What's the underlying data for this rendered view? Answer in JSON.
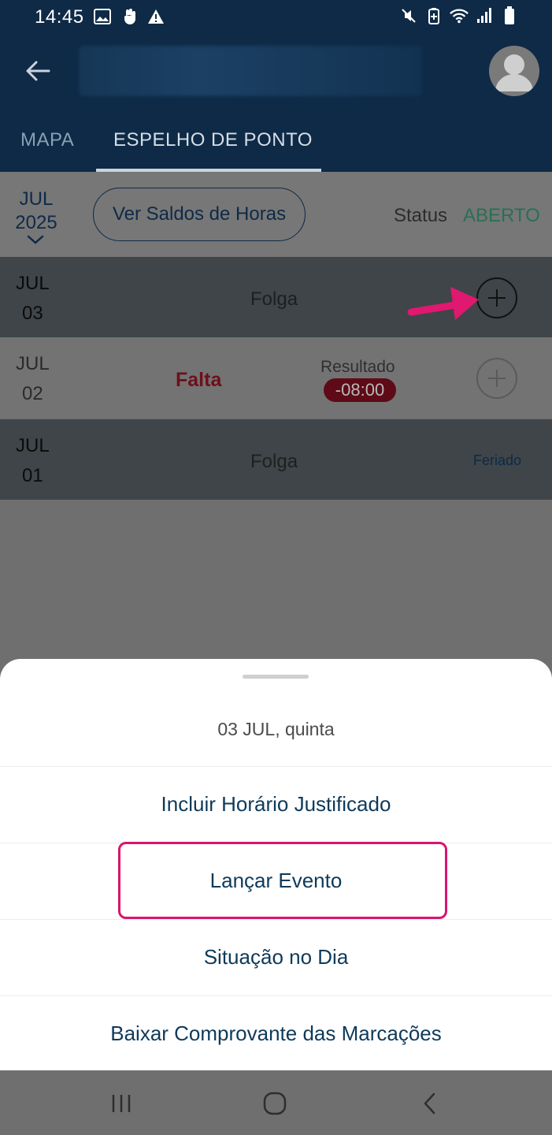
{
  "status_bar": {
    "time": "14:45",
    "left_icons": [
      "image-icon",
      "hand-icon",
      "warning-icon"
    ],
    "right_icons": [
      "mute-icon",
      "battery-saver-icon",
      "wifi-icon",
      "signal-icon",
      "battery-icon"
    ]
  },
  "app_bar": {
    "back_icon": "arrow-left-icon",
    "avatar_icon": "user-icon"
  },
  "tabs": [
    {
      "label": "MAPA",
      "active": false
    },
    {
      "label": "ESPELHO DE PONTO",
      "active": true
    }
  ],
  "period": {
    "month": "JUL",
    "year": "2025",
    "saldos_button": "Ver Saldos de Horas",
    "status_label": "Status",
    "status_value": "ABERTO"
  },
  "days": [
    {
      "month": "JUL",
      "day": "03",
      "label": "Folga"
    },
    {
      "month": "JUL",
      "day": "02",
      "label": "Falta",
      "result_label": "Resultado",
      "result_value": "-08:00"
    },
    {
      "month": "JUL",
      "day": "01",
      "label": "Folga",
      "tag": "Feriado"
    }
  ],
  "sheet": {
    "title": "03 JUL, quinta",
    "items": [
      "Incluir Horário Justificado",
      "Lançar Evento",
      "Situação no Dia",
      "Baixar Comprovante das Marcações"
    ]
  },
  "colors": {
    "primary": "#0e2a47",
    "highlight": "#d8156d",
    "status_open": "#2a6f55",
    "falta": "#6e0f1a"
  }
}
